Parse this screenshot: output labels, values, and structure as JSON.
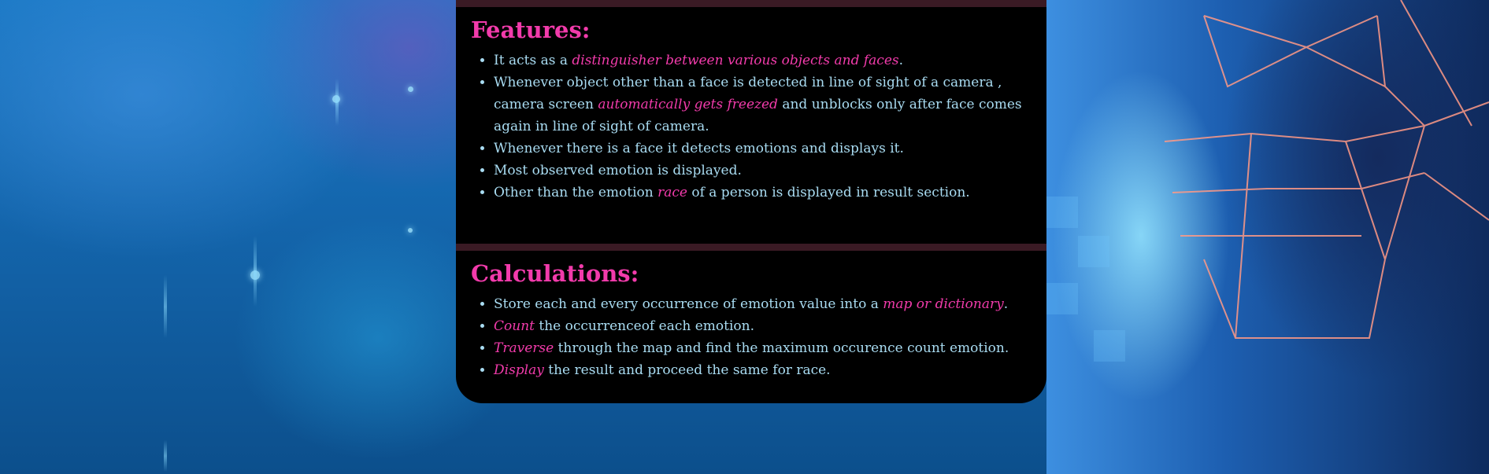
{
  "features": {
    "heading": "Features:",
    "items": [
      {
        "before": "It acts as a ",
        "em": "distinguisher between various objects and faces",
        "after": "."
      },
      {
        "before": "Whenever object other than a face is detected in line of sight of a camera , camera screen ",
        "em": "automatically gets freezed",
        "after": " and unblocks only after face comes again in line of sight of camera."
      },
      {
        "before": "Whenever there is a face it detects emotions and displays it.",
        "em": "",
        "after": ""
      },
      {
        "before": "Most observed emotion is displayed.",
        "em": "",
        "after": ""
      },
      {
        "before": "Other than the emotion ",
        "em": "race",
        "after": " of a person is displayed in result section."
      }
    ]
  },
  "calculations": {
    "heading": "Calculations:",
    "items": [
      {
        "before": "Store each and every occurrence of emotion value into a ",
        "em": "map or dictionary",
        "after": "."
      },
      {
        "before": "",
        "em": "Count",
        "after": " the occurrenceof each emotion."
      },
      {
        "before": "",
        "em": "Traverse",
        "after": " through the map and find the maximum occurence count emotion."
      },
      {
        "before": "",
        "em": "Display",
        "after": " the result and proceed the same for race."
      }
    ]
  },
  "colors": {
    "heading": "#f23bab",
    "body_text": "#a9dcf2",
    "emphasis": "#f23bab",
    "panel_bg": "#000000",
    "divider": "#3a1a24"
  },
  "icons": {
    "background_left": "blue-particles-image",
    "background_right": "digital-face-wireframe-image"
  }
}
